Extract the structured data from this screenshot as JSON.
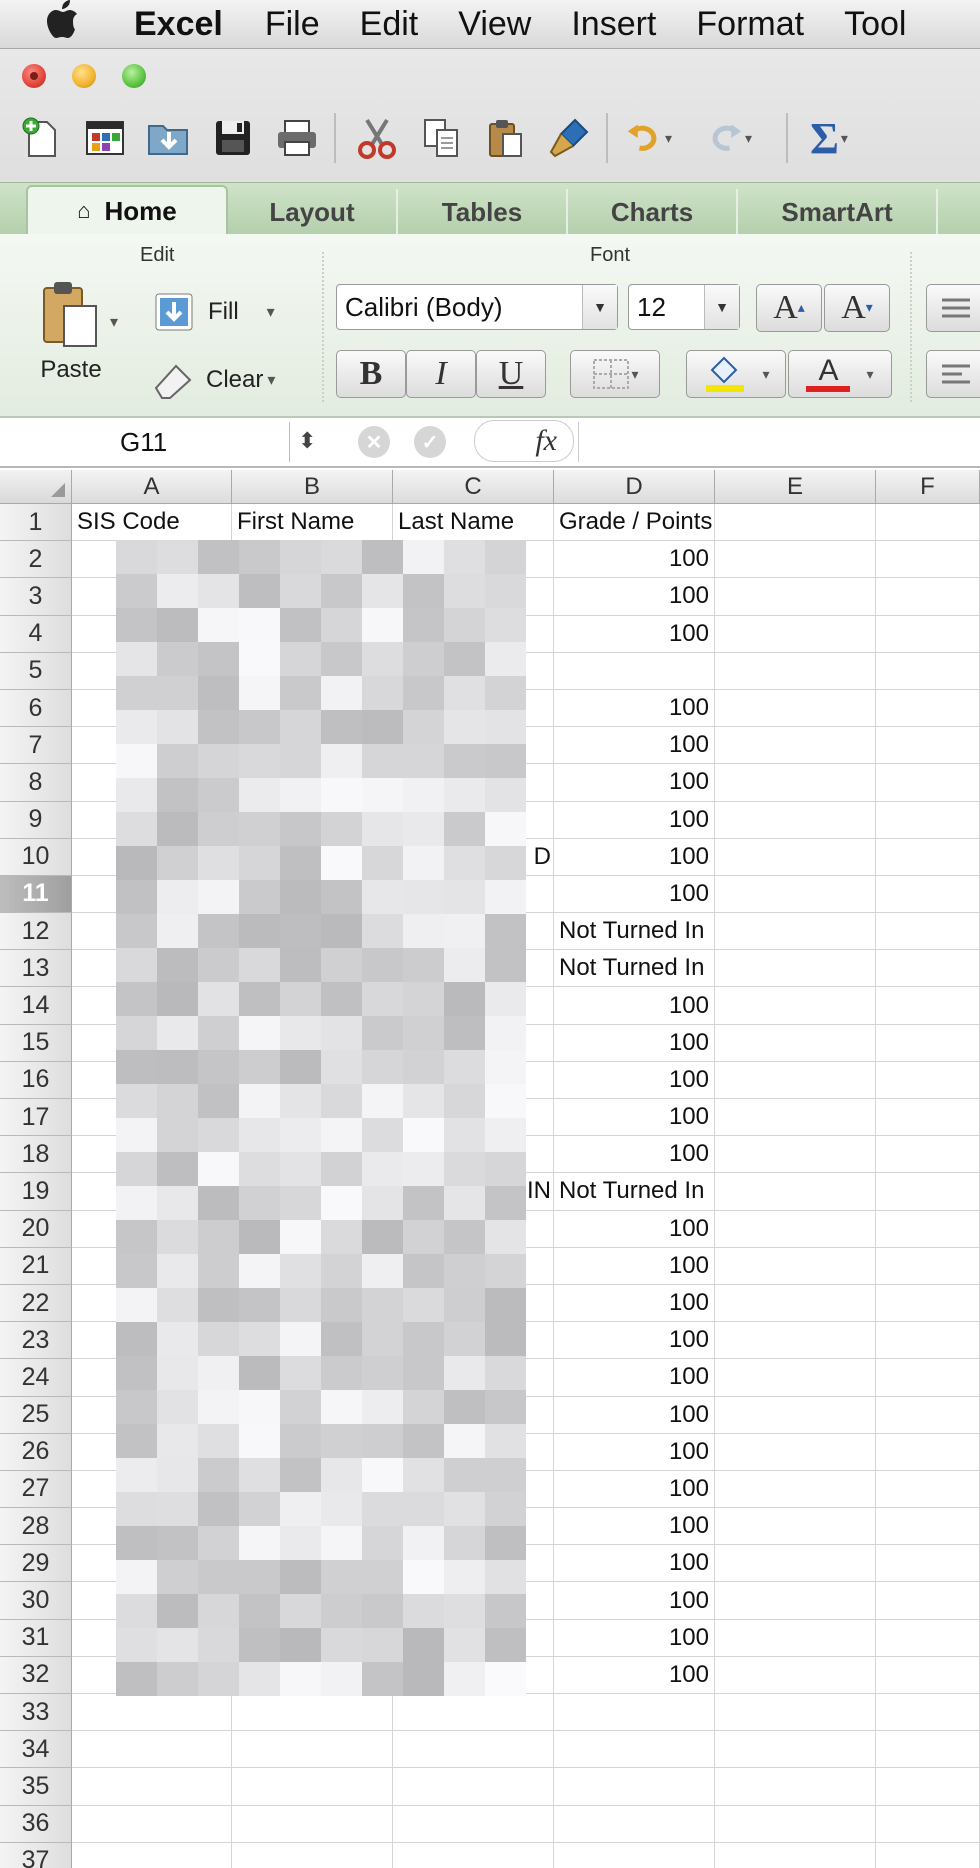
{
  "menubar": {
    "app": "Excel",
    "items": [
      "File",
      "Edit",
      "View",
      "Insert",
      "Format",
      "Tool"
    ]
  },
  "toolbar": {
    "icons": [
      "new-workbook-icon",
      "templates-icon",
      "open-icon",
      "save-icon",
      "print-icon",
      "cut-icon",
      "copy-icon",
      "paste-icon",
      "format-painter-icon",
      "undo-icon",
      "redo-icon",
      "autosum-icon"
    ]
  },
  "ribbon": {
    "tabs": [
      "Home",
      "Layout",
      "Tables",
      "Charts",
      "SmartArt"
    ],
    "active_tab": "Home",
    "edit_group": {
      "title": "Edit",
      "paste": "Paste",
      "fill": "Fill",
      "clear": "Clear"
    },
    "font_group": {
      "title": "Font",
      "font_name": "Calibri (Body)",
      "font_size": "12",
      "bold": "B",
      "italic": "I",
      "underline": "U",
      "grow": "A",
      "shrink": "A",
      "font_color": "A"
    },
    "colors": {
      "highlight": "#f3e600",
      "font_color": "#e0201e",
      "tab_green": "#c3dbbd"
    }
  },
  "formula_bar": {
    "cell_ref": "G11",
    "fx": "fx",
    "value": ""
  },
  "sheet": {
    "columns": [
      "A",
      "B",
      "C",
      "D",
      "E",
      "F"
    ],
    "selected_row": 11,
    "header_row": {
      "a": "SIS Code",
      "b": "First Name",
      "c": "Last Name",
      "d": "Grade / Points"
    },
    "rows": [
      {
        "n": "2",
        "c": "",
        "d": "100"
      },
      {
        "n": "3",
        "c": "",
        "d": "100"
      },
      {
        "n": "4",
        "c": "",
        "d": "100"
      },
      {
        "n": "5",
        "c": "",
        "d": ""
      },
      {
        "n": "6",
        "c": "",
        "d": "100"
      },
      {
        "n": "7",
        "c": "",
        "d": "100"
      },
      {
        "n": "8",
        "c": "",
        "d": "100"
      },
      {
        "n": "9",
        "c": "",
        "d": "100"
      },
      {
        "n": "10",
        "c": "D",
        "d": "100"
      },
      {
        "n": "11",
        "c": "",
        "d": "100"
      },
      {
        "n": "12",
        "c": "",
        "d": "Not Turned In"
      },
      {
        "n": "13",
        "c": "",
        "d": "Not Turned In"
      },
      {
        "n": "14",
        "c": "",
        "d": "100"
      },
      {
        "n": "15",
        "c": "",
        "d": "100"
      },
      {
        "n": "16",
        "c": "",
        "d": "100"
      },
      {
        "n": "17",
        "c": "",
        "d": "100"
      },
      {
        "n": "18",
        "c": "",
        "d": "100"
      },
      {
        "n": "19",
        "c": "IN",
        "d": "Not Turned In"
      },
      {
        "n": "20",
        "c": "",
        "d": "100"
      },
      {
        "n": "21",
        "c": "",
        "d": "100"
      },
      {
        "n": "22",
        "c": "",
        "d": "100"
      },
      {
        "n": "23",
        "c": "",
        "d": "100"
      },
      {
        "n": "24",
        "c": "",
        "d": "100"
      },
      {
        "n": "25",
        "c": "",
        "d": "100"
      },
      {
        "n": "26",
        "c": "",
        "d": "100"
      },
      {
        "n": "27",
        "c": "",
        "d": "100"
      },
      {
        "n": "28",
        "c": "",
        "d": "100"
      },
      {
        "n": "29",
        "c": "",
        "d": "100"
      },
      {
        "n": "30",
        "c": "",
        "d": "100"
      },
      {
        "n": "31",
        "c": "",
        "d": "100"
      },
      {
        "n": "32",
        "c": "",
        "d": "100"
      },
      {
        "n": "33",
        "c": "",
        "d": ""
      },
      {
        "n": "34",
        "c": "",
        "d": ""
      },
      {
        "n": "35",
        "c": "",
        "d": ""
      },
      {
        "n": "36",
        "c": "",
        "d": ""
      },
      {
        "n": "37",
        "c": "",
        "d": ""
      }
    ]
  }
}
